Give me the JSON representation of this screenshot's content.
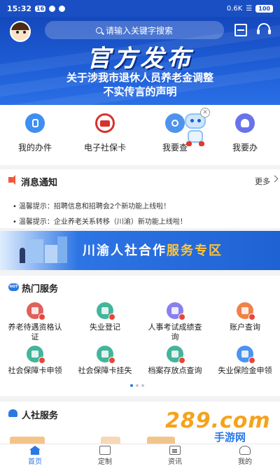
{
  "status_bar": {
    "time": "15:32",
    "badge": "16",
    "network_speed": "0.6K",
    "battery": "100"
  },
  "header": {
    "search_placeholder": "请输入关键字搜索",
    "icons": [
      "avatar",
      "scan-icon",
      "headset-icon"
    ]
  },
  "banner": {
    "title": "官方发布",
    "line1": "关于涉我市退休人员养老金调整",
    "line2": "不实传言的声明"
  },
  "quick_actions": [
    {
      "label": "我的办件",
      "icon": "hand-icon"
    },
    {
      "label": "电子社保卡",
      "icon": "card-icon"
    },
    {
      "label": "我要查",
      "icon": "search-icon"
    },
    {
      "label": "我要办",
      "icon": "person-icon"
    }
  ],
  "notices": {
    "title": "消息通知",
    "more": "更多",
    "items": [
      "温馨提示：招聘信息和招聘会2个新功能上线啦！",
      "温馨提示：企业养老关系转移（川渝）新功能上线啦！"
    ]
  },
  "promo": {
    "text_main": "川渝人社合作",
    "text_highlight": "服务专区"
  },
  "hot_services": {
    "badge": "HOT",
    "title": "热门服务",
    "items": [
      {
        "label": "养老待遇资格认证",
        "color": "#e0615a"
      },
      {
        "label": "失业登记",
        "color": "#43b59a"
      },
      {
        "label": "人事考试成绩查询",
        "color": "#8a7ff0"
      },
      {
        "label": "账户查询",
        "color": "#f08247"
      },
      {
        "label": "社会保障卡申领",
        "color": "#43b59a"
      },
      {
        "label": "社会保障卡挂失",
        "color": "#43b59a"
      },
      {
        "label": "档案存放点查询",
        "color": "#43b59a"
      },
      {
        "label": "失业保险金申领",
        "color": "#4c93ef"
      }
    ]
  },
  "hr_services": {
    "title": "人社服务"
  },
  "watermark": {
    "number": "289.com",
    "text": "手游网"
  },
  "tabbar": [
    {
      "label": "首页",
      "icon": "home-icon",
      "active": true
    },
    {
      "label": "定制",
      "icon": "customize-icon",
      "active": false
    },
    {
      "label": "资讯",
      "icon": "news-icon",
      "active": false
    },
    {
      "label": "我的",
      "icon": "profile-icon",
      "active": false
    }
  ],
  "colors": {
    "primary": "#1f5fd8",
    "accent": "#2b78e4",
    "highlight": "#ffc53a"
  }
}
